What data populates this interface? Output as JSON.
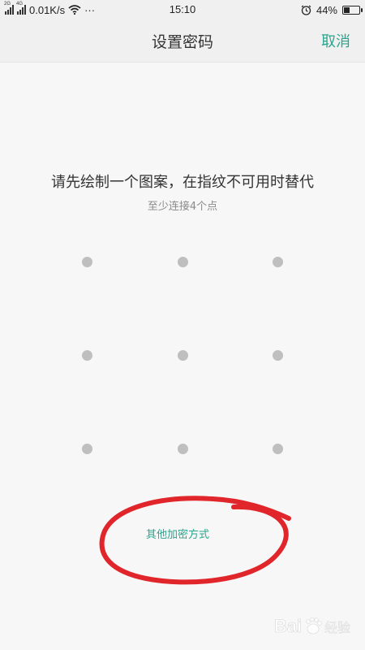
{
  "status_bar": {
    "sim1_tag": "2G",
    "sim2_tag": "4G",
    "network_speed": "0.01K/s",
    "more": "···",
    "time": "15:10",
    "battery_percent": "44%",
    "battery_level": 0.44,
    "icons": [
      "signal-icon",
      "signal-icon",
      "wifi-icon",
      "alarm-icon",
      "battery-icon"
    ]
  },
  "header": {
    "title": "设置密码",
    "cancel_label": "取消"
  },
  "prompt": {
    "title": "请先绘制一个图案，在指纹不可用时替代",
    "hint": "至少连接4个点"
  },
  "pattern": {
    "rows": 3,
    "cols": 3
  },
  "footer": {
    "other_methods_label": "其他加密方式"
  },
  "colors": {
    "accent": "#2aa48f",
    "dot": "#bfbfbf",
    "annotation": "#e0262b",
    "background": "#f7f7f7"
  },
  "watermark": {
    "brand": "Baidu",
    "sub": "经验"
  }
}
